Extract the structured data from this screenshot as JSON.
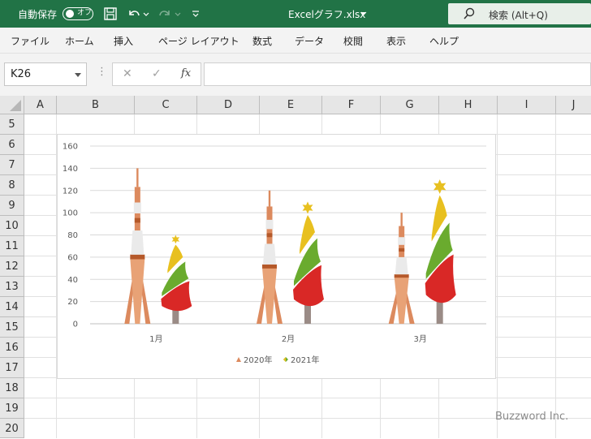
{
  "titlebar": {
    "autosave_label": "自動保存",
    "autosave_state": "オフ",
    "doc_title": "Excelグラフ.xlsx",
    "search_label": "検索 (Alt+Q)"
  },
  "menu": [
    "ファイル",
    "ホーム",
    "挿入",
    "ページ レイアウト",
    "数式",
    "データ",
    "校閲",
    "表示",
    "ヘルプ"
  ],
  "formula_bar": {
    "name_box": "K26",
    "cancel_icon": "✕",
    "enter_icon": "✓",
    "fx_label": "fx",
    "formula": ""
  },
  "columns": [
    "A",
    "B",
    "C",
    "D",
    "E",
    "F",
    "G",
    "H",
    "I",
    "J"
  ],
  "rows": [
    "5",
    "6",
    "7",
    "8",
    "9",
    "10",
    "11",
    "12",
    "13",
    "14",
    "15",
    "16",
    "17",
    "18",
    "19",
    "20"
  ],
  "colors": {
    "excel_green": "#217346",
    "tower": "#dc8a5e",
    "tree_yellow": "#e8c01f",
    "tree_green": "#6aab2e",
    "tree_red": "#d92826",
    "trunk": "#9a8b86"
  },
  "chart_data": {
    "type": "bar",
    "title": "",
    "xlabel": "",
    "ylabel": "",
    "categories": [
      "1月",
      "2月",
      "3月"
    ],
    "series": [
      {
        "name": "2020年",
        "values": [
          140,
          120,
          100
        ],
        "marker": "tower-icon"
      },
      {
        "name": "2021年",
        "values": [
          80,
          110,
          130
        ],
        "marker": "christmas-tree-icon"
      }
    ],
    "ylim": [
      0,
      160
    ],
    "yticks": [
      "0",
      "20",
      "40",
      "60",
      "80",
      "100",
      "120",
      "140",
      "160"
    ],
    "grid": true,
    "legend": "bottom"
  },
  "watermark": "Buzzword Inc."
}
